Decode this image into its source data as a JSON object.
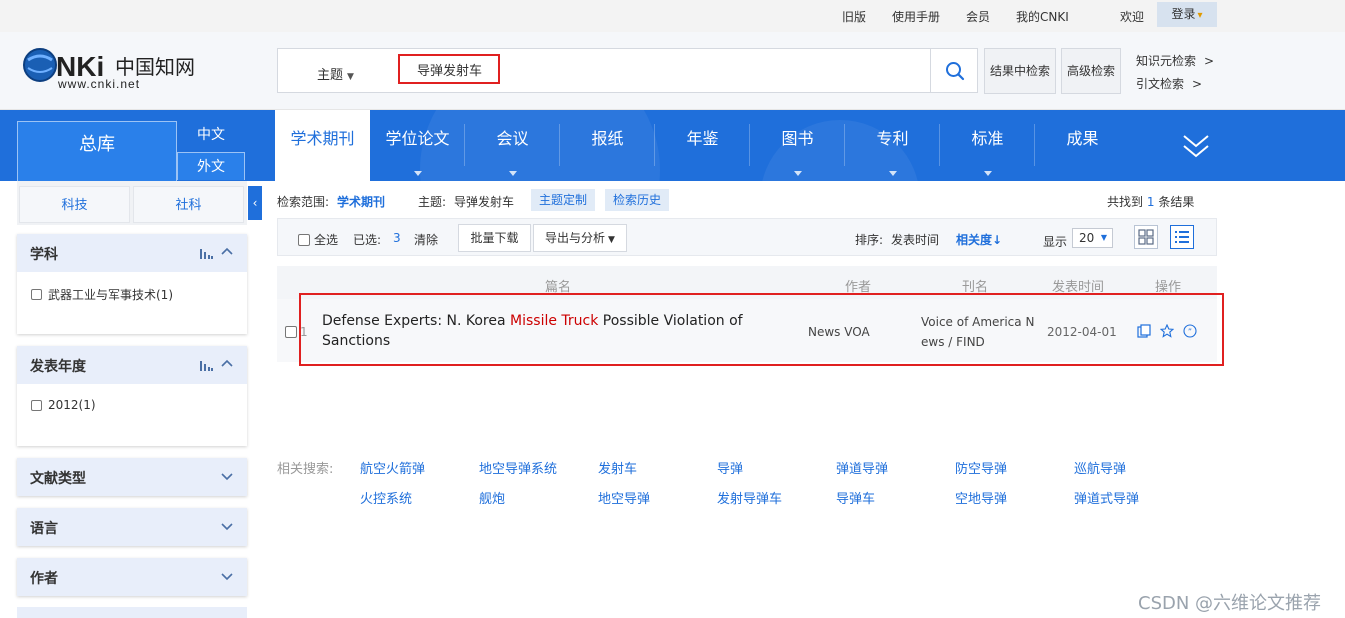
{
  "topbar": {
    "links": [
      "旧版",
      "使用手册",
      "会员",
      "我的CNKI"
    ],
    "welcome": "欢迎",
    "login": "登录"
  },
  "header": {
    "logo_alt": "CNKi中国知网 www.cnki.net",
    "logo_url_text": "www.cnki.net",
    "field": "主题",
    "query": "导弹发射车",
    "search_icon": "search-icon",
    "result_search": "结果中检索",
    "advanced_search": "高级检索",
    "knowledge_search": "知识元检索",
    "citation_search": "引文检索",
    "arrow": ">"
  },
  "nav": {
    "zongku": "总库",
    "lang_zh": "中文",
    "lang_en": "外文",
    "tabs": [
      "学术期刊",
      "学位论文",
      "会议",
      "报纸",
      "年鉴",
      "图书",
      "专利",
      "标准",
      "成果"
    ],
    "active_tab": "学术期刊",
    "colors": {
      "blue": "#1f6fdb",
      "highlight": "#e02020"
    }
  },
  "sidebar": {
    "subject_tabs": [
      "科技",
      "社科"
    ],
    "facets": [
      {
        "title": "学科",
        "items": [
          "武器工业与军事技术(1)"
        ]
      },
      {
        "title": "发表年度",
        "items": [
          "2012(1)"
        ]
      },
      {
        "title": "文献类型"
      },
      {
        "title": "语言"
      },
      {
        "title": "作者"
      }
    ]
  },
  "results": {
    "scope_label": "检索范围:",
    "scope_value": "学术期刊",
    "topic_label": "主题:",
    "topic_value": "导弹发射车",
    "topic_custom": "主题定制",
    "search_history": "检索历史",
    "found_prefix": "共找到",
    "found_count": "1",
    "found_suffix": "条结果",
    "select_all": "全选",
    "selected_label": "已选:",
    "selected_count": "3",
    "clear": "清除",
    "batch_download": "批量下载",
    "export": "导出与分析",
    "sort_label": "排序:",
    "sort_date": "发表时间",
    "sort_relevance": "相关度",
    "show_label": "显示",
    "show_value": "20",
    "columns": [
      "篇名",
      "作者",
      "刊名",
      "发表时间",
      "操作"
    ],
    "rows": [
      {
        "index": "1",
        "title_pre": "Defense Experts: N. Korea ",
        "title_hl": "Missile Truck",
        "title_post": " Possible Violation of Sanctions",
        "author": "News VOA",
        "journal_line1": "Voice of America N",
        "journal_line2": "ews / FIND",
        "date": "2012-04-01"
      }
    ]
  },
  "related": {
    "label": "相关搜索:",
    "row1": [
      "航空火箭弹",
      "地空导弹系统",
      "发射车",
      "导弹",
      "弹道导弹",
      "防空导弹",
      "巡航导弹"
    ],
    "row2": [
      "火控系统",
      "舰炮",
      "地空导弹",
      "发射导弹车",
      "导弹车",
      "空地导弹",
      "弹道式导弹"
    ]
  },
  "watermark": "CSDN @六维论文推荐"
}
